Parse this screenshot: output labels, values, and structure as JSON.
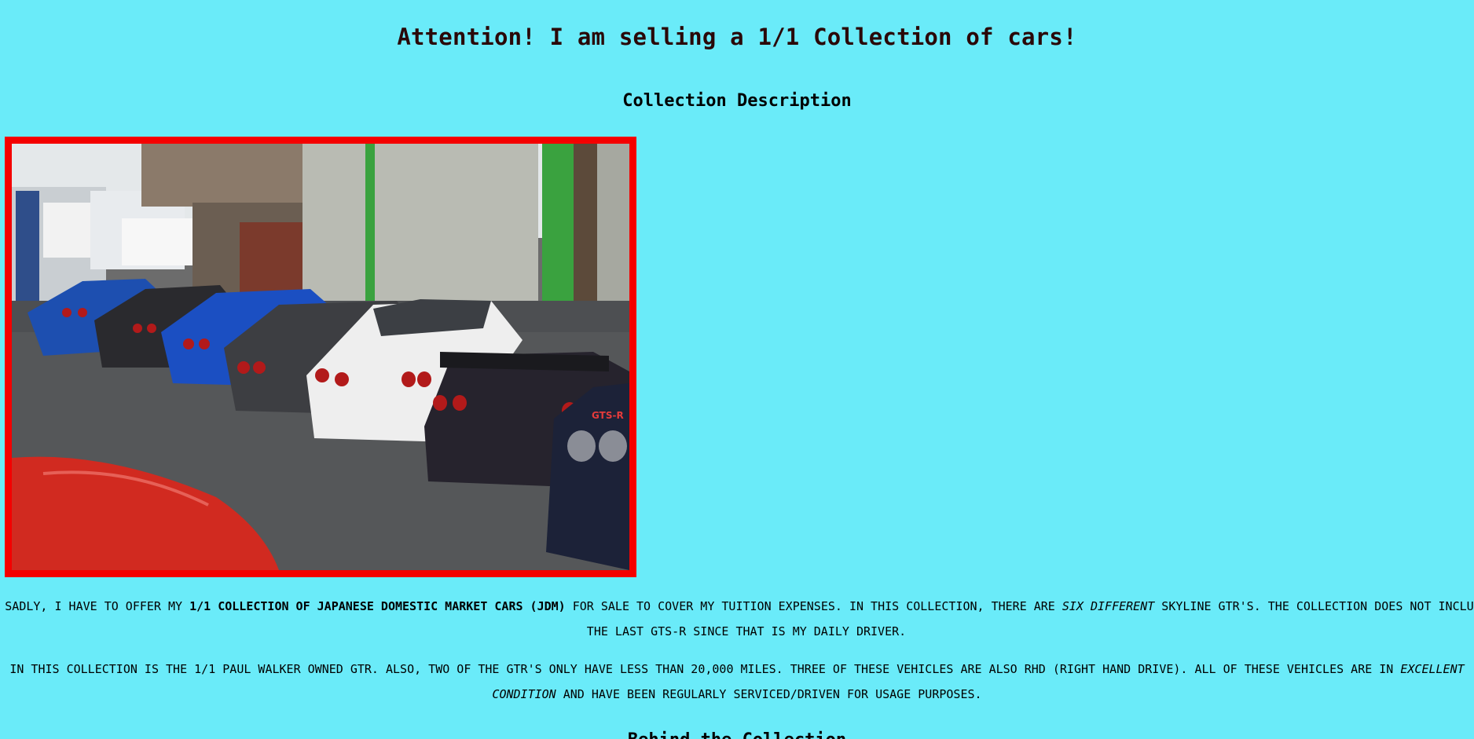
{
  "page": {
    "title": "Attention! I am selling a 1/1 Collection of cars!",
    "section_description": "Collection Description",
    "section_behind": "Behind the Collection"
  },
  "photo": {
    "alt": "Row of Nissan Skyline GT-R cars parked outside a garage",
    "border_color": "#f40000",
    "badge_text": "GTS-R"
  },
  "paragraph1": {
    "t1": "Sadly, I have to offer my ",
    "b1": "1/1 collection of Japanese Domestic Market Cars (JDM)",
    "t2": " for sale to cover my tuition expenses. In this collection, there are ",
    "i1": "six different",
    "t3": " Skyline GTR's. The collection does not include the last GTS-R since that is my daily driver."
  },
  "paragraph2": {
    "t1": "In this collection is the 1/1 Paul Walker owned GTR. Also, two of the GTR's only have less than 20,000 miles. Three of these vehicles are also RHD (Right Hand Drive). All of these vehicles are in ",
    "i1": "excellent condition",
    "t2": " and have been regularly serviced/driven for usage purposes."
  },
  "colors": {
    "background": "#6aebf9",
    "heading": "#2a0808",
    "frame": "#f40000"
  }
}
